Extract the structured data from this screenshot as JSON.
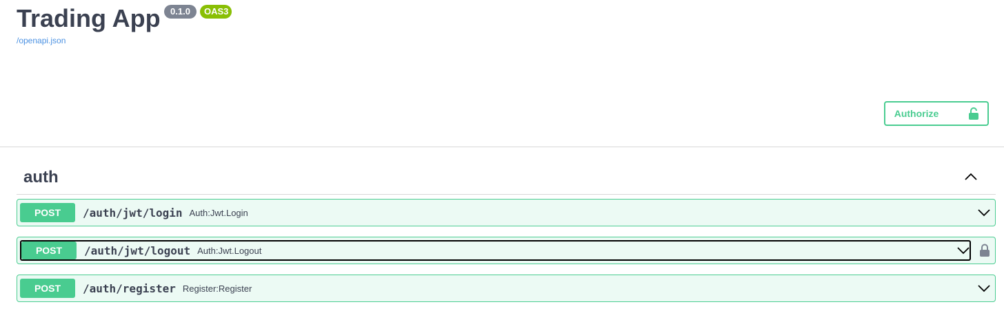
{
  "info": {
    "title": "Trading App",
    "version": "0.1.0",
    "oas": "OAS3",
    "spec_link": "/openapi.json"
  },
  "toolbar": {
    "authorize_label": "Authorize"
  },
  "tag": {
    "name": "auth"
  },
  "operations": [
    {
      "method": "POST",
      "path": "/auth/jwt/login",
      "summary": "Auth:Jwt.Login"
    },
    {
      "method": "POST",
      "path": "/auth/jwt/logout",
      "summary": "Auth:Jwt.Logout"
    },
    {
      "method": "POST",
      "path": "/auth/register",
      "summary": "Register:Register"
    }
  ],
  "colors": {
    "post": "#49cc90",
    "version_badge": "#7d8492",
    "oas_badge": "#89bf04",
    "link": "#4990e2"
  }
}
